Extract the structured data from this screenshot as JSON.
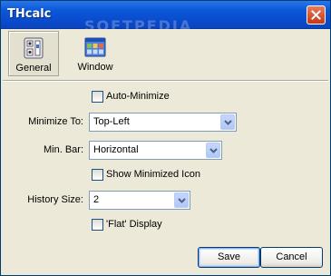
{
  "window": {
    "title": "THcalc",
    "watermark": "SOFTPEDIA"
  },
  "tabs": [
    {
      "label": "General",
      "icon": "general-settings-icon",
      "selected": true
    },
    {
      "label": "Window",
      "icon": "window-settings-icon",
      "selected": false
    }
  ],
  "form": {
    "auto_minimize": {
      "label": "Auto-Minimize",
      "checked": false
    },
    "minimize_to": {
      "label": "Minimize To:",
      "value": "Top-Left"
    },
    "min_bar": {
      "label": "Min. Bar:",
      "value": "Horizontal"
    },
    "show_minimized_icon": {
      "label": "Show Minimized Icon",
      "checked": false
    },
    "history_size": {
      "label": "History Size:",
      "value": "2"
    },
    "flat_display": {
      "label": "'Flat' Display",
      "checked": false
    }
  },
  "buttons": {
    "save": "Save",
    "cancel": "Cancel"
  },
  "colors": {
    "titlebar": "#0a58d8",
    "window_bg": "#ece9d8",
    "close_button": "#c63816",
    "button_border": "#003c74"
  }
}
